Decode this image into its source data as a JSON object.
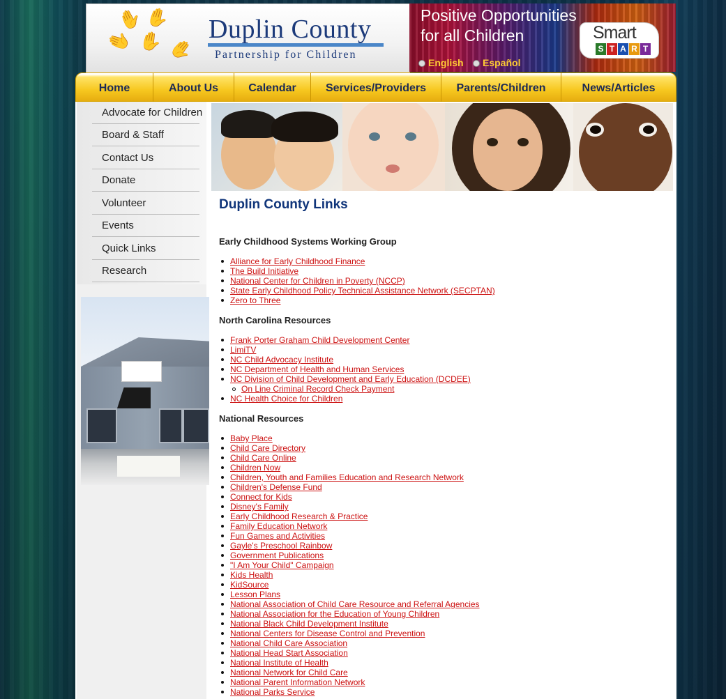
{
  "logo": {
    "title_big": "Duplin County",
    "subtitle": "Partnership for Children"
  },
  "promo": {
    "line1": "Positive Opportunities",
    "line2": "for all Children",
    "smart_word": "Smart",
    "start_letters": [
      "S",
      "T",
      "A",
      "R",
      "T"
    ],
    "start_colors": [
      "#2a7a2a",
      "#cc2222",
      "#1a50b0",
      "#e89a10",
      "#7a2a9a"
    ]
  },
  "languages": [
    "English",
    "Español"
  ],
  "nav": [
    "Home",
    "About Us",
    "Calendar",
    "Services/Providers",
    "Parents/Children",
    "News/Articles"
  ],
  "sidebar": [
    "Advocate for Children",
    "Board & Staff",
    "Contact Us",
    "Donate",
    "Volunteer",
    "Events",
    "Quick Links",
    "Research"
  ],
  "main": {
    "title": "Duplin County Links",
    "sections": [
      {
        "heading": "Early Childhood Systems Working Group",
        "links": [
          {
            "text": "Alliance for Early Childhood Finance"
          },
          {
            "text": "The Build Initiative"
          },
          {
            "text": "National Center for Children in Poverty (NCCP)"
          },
          {
            "text": "State Early Childhood Policy Technical Assistance Network (SECPTAN)"
          },
          {
            "text": "Zero to Three "
          }
        ]
      },
      {
        "heading": "North Carolina Resources",
        "links": [
          {
            "text": "Frank Porter Graham Child Development Center"
          },
          {
            "text": "LimiTV"
          },
          {
            "text": "NC Child Advocacy Institute"
          },
          {
            "text": "NC Department of Health and Human Services"
          },
          {
            "text": "NC Division of Child Development and Early Education (DCDEE)"
          },
          {
            "text": "On Line Criminal Record Check Payment",
            "sub": true
          },
          {
            "text": "NC Health Choice for Children"
          }
        ]
      },
      {
        "heading": "National Resources",
        "links": [
          {
            "text": "Baby Place"
          },
          {
            "text": "Child Care Directory"
          },
          {
            "text": "Child Care Online"
          },
          {
            "text": "Children Now"
          },
          {
            "text": "Children, Youth and Families Education and Research Network"
          },
          {
            "text": "Children's Defense Fund"
          },
          {
            "text": "Connect for Kids"
          },
          {
            "text": "Disney's Family"
          },
          {
            "text": "Early Childhood Research & Practice"
          },
          {
            "text": "Family Education Network"
          },
          {
            "text": "Fun Games and Activities"
          },
          {
            "text": "Gayle's Preschool Rainbow"
          },
          {
            "text": "Government Publications"
          },
          {
            "text": "\"I Am Your Child\" Campaign"
          },
          {
            "text": "Kids Health"
          },
          {
            "text": "KidSource"
          },
          {
            "text": "Lesson Plans"
          },
          {
            "text": "National Association of Child Care Resource and Referral Agencies"
          },
          {
            "text": "National Association for the Education of Young Children"
          },
          {
            "text": "National Black Child Development Institute"
          },
          {
            "text": "National Centers for Disease Control and Prevention"
          },
          {
            "text": "National Child Care Association"
          },
          {
            "text": "National Head Start Association"
          },
          {
            "text": "National Institute of Health"
          },
          {
            "text": "National Network for Child Care"
          },
          {
            "text": "National Parent Information Network"
          },
          {
            "text": "National Parks Service"
          }
        ]
      }
    ]
  }
}
